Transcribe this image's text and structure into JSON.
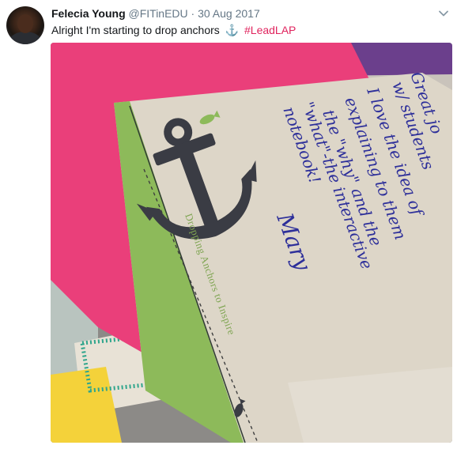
{
  "tweet": {
    "author_name": "Felecia Young",
    "handle": "@FITinEDU",
    "separator": "·",
    "date": "30 Aug 2017",
    "text": "Alright I'm starting to drop anchors",
    "anchor_emoji": "⚓",
    "hashtag": "#LeadLAP"
  },
  "card": {
    "caption": "Dropping Anchors to Inspire",
    "handwriting_lines": [
      "Great jo",
      "w/ students",
      "I love the idea of",
      "explaining to them",
      "the \"why\" and the",
      "\"what\"-the interactive",
      "notebook!",
      "Mary"
    ]
  },
  "colors": {
    "link": "#1da1f2",
    "hashtag": "#e0245e",
    "ink": "#2d2f9a",
    "card_green": "#8dba5a",
    "pink_folder": "#ea3f7a",
    "purple_paper": "#6b3f8c"
  },
  "icons": {
    "caret": "chevron-down-icon",
    "anchor": "anchor-icon",
    "fish": "fish-icon"
  }
}
